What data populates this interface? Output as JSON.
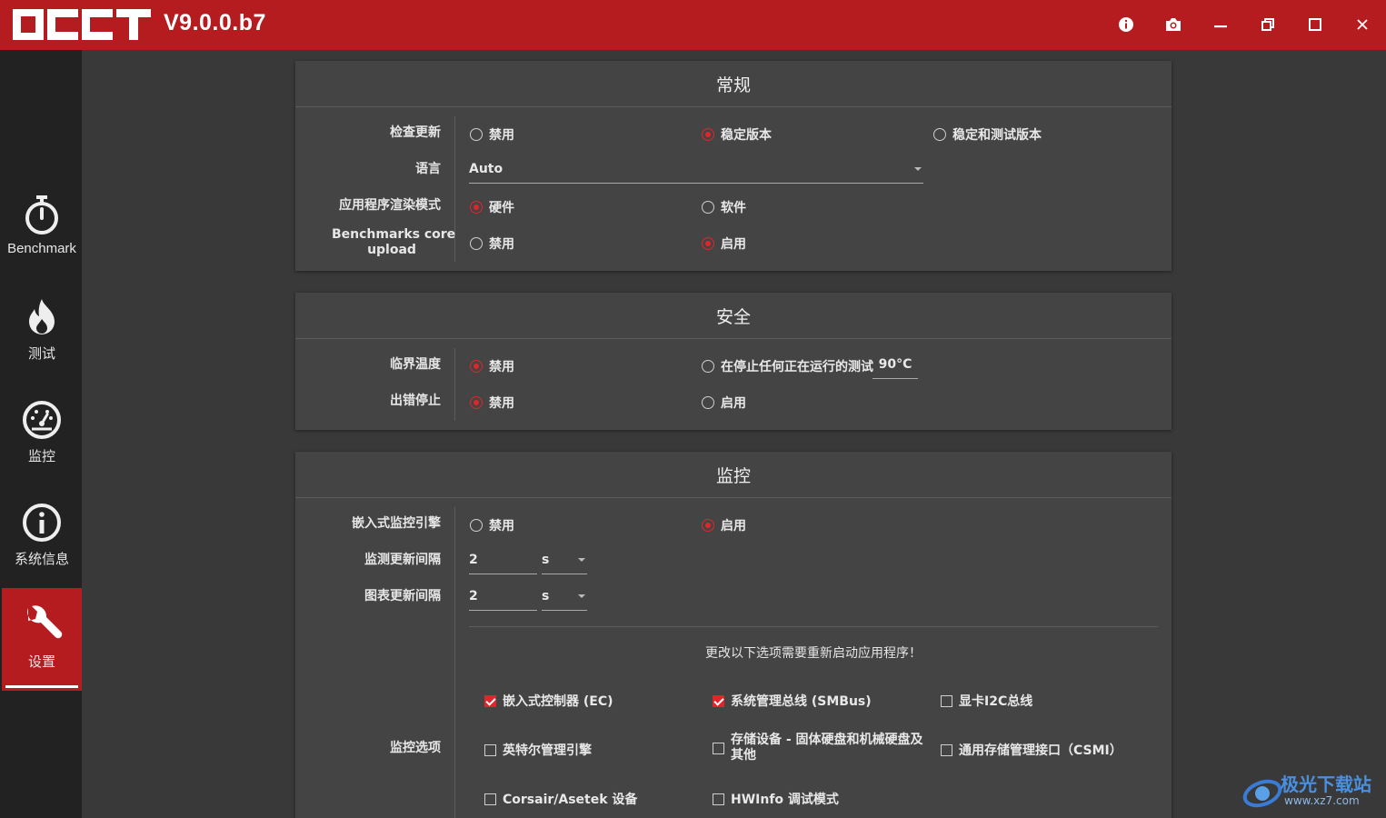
{
  "app": {
    "logo_text": "OCCT",
    "version": "V9.0.0.b7"
  },
  "titlebar": {
    "buttons": [
      {
        "icon": "info-icon"
      },
      {
        "icon": "camera-icon"
      },
      {
        "icon": "minimize-icon"
      },
      {
        "icon": "restore-icon"
      },
      {
        "icon": "maximize-icon"
      },
      {
        "icon": "close-icon"
      }
    ]
  },
  "sidebar": {
    "items": [
      {
        "label": "Benchmark",
        "icon": "stopwatch-icon",
        "active": false
      },
      {
        "label": "测试",
        "icon": "flame-icon",
        "active": false
      },
      {
        "label": "监控",
        "icon": "gauge-icon",
        "active": false
      },
      {
        "label": "系统信息",
        "icon": "info-circle-icon",
        "active": false
      },
      {
        "label": "设置",
        "icon": "wrench-icon",
        "active": true
      }
    ]
  },
  "general": {
    "title": "常规",
    "check_update": {
      "label": "检查更新",
      "options": [
        "禁用",
        "稳定版本",
        "稳定和测试版本"
      ],
      "selected": 1
    },
    "language": {
      "label": "语言",
      "value": "Auto"
    },
    "render_mode": {
      "label": "应用程序渲染模式",
      "options": [
        "硬件",
        "软件"
      ],
      "selected": 0
    },
    "bench_upload": {
      "label_line1": "Benchmarks core",
      "label_line2": "upload",
      "options": [
        "禁用",
        "启用"
      ],
      "selected": 1
    }
  },
  "safety": {
    "title": "安全",
    "critical_temp": {
      "label": "临界温度",
      "options": [
        "禁用",
        "在停止任何正在运行的测试"
      ],
      "selected": 0,
      "temp_value": "90°C"
    },
    "stop_on_error": {
      "label": "出错停止",
      "options": [
        "禁用",
        "启用"
      ],
      "selected": 0
    }
  },
  "monitoring": {
    "title": "监控",
    "embedded_engine": {
      "label": "嵌入式监控引擎",
      "options": [
        "禁用",
        "启用"
      ],
      "selected": 1
    },
    "monitor_interval": {
      "label": "监测更新间隔",
      "value": "2",
      "unit": "s"
    },
    "chart_interval": {
      "label": "图表更新间隔",
      "value": "2",
      "unit": "s"
    },
    "restart_note": "更改以下选项需要重新启动应用程序！",
    "options_label": "监控选项",
    "checkboxes": [
      {
        "label": "嵌入式控制器 (EC)",
        "checked": true
      },
      {
        "label": "系统管理总线 (SMBus)",
        "checked": true
      },
      {
        "label": "显卡I2C总线",
        "checked": false
      },
      {
        "label": "英特尔管理引擎",
        "checked": false
      },
      {
        "label_line1": "存储设备 - 固体硬盘和机械硬盘及",
        "label_line2": "其他",
        "checked": false
      },
      {
        "label": "通用存储管理接口（CSMI）",
        "checked": false
      },
      {
        "label": "Corsair/Asetek 设备",
        "checked": false
      },
      {
        "label": "HWInfo 调试模式",
        "checked": false
      }
    ]
  },
  "watermark": {
    "text": "极光下载站",
    "url": "www.xz7.com"
  },
  "colors": {
    "accent": "#b51c1f",
    "radio_on": "#e0262c",
    "panel": "#444444",
    "background": "#393939",
    "sidebar": "#222222"
  }
}
